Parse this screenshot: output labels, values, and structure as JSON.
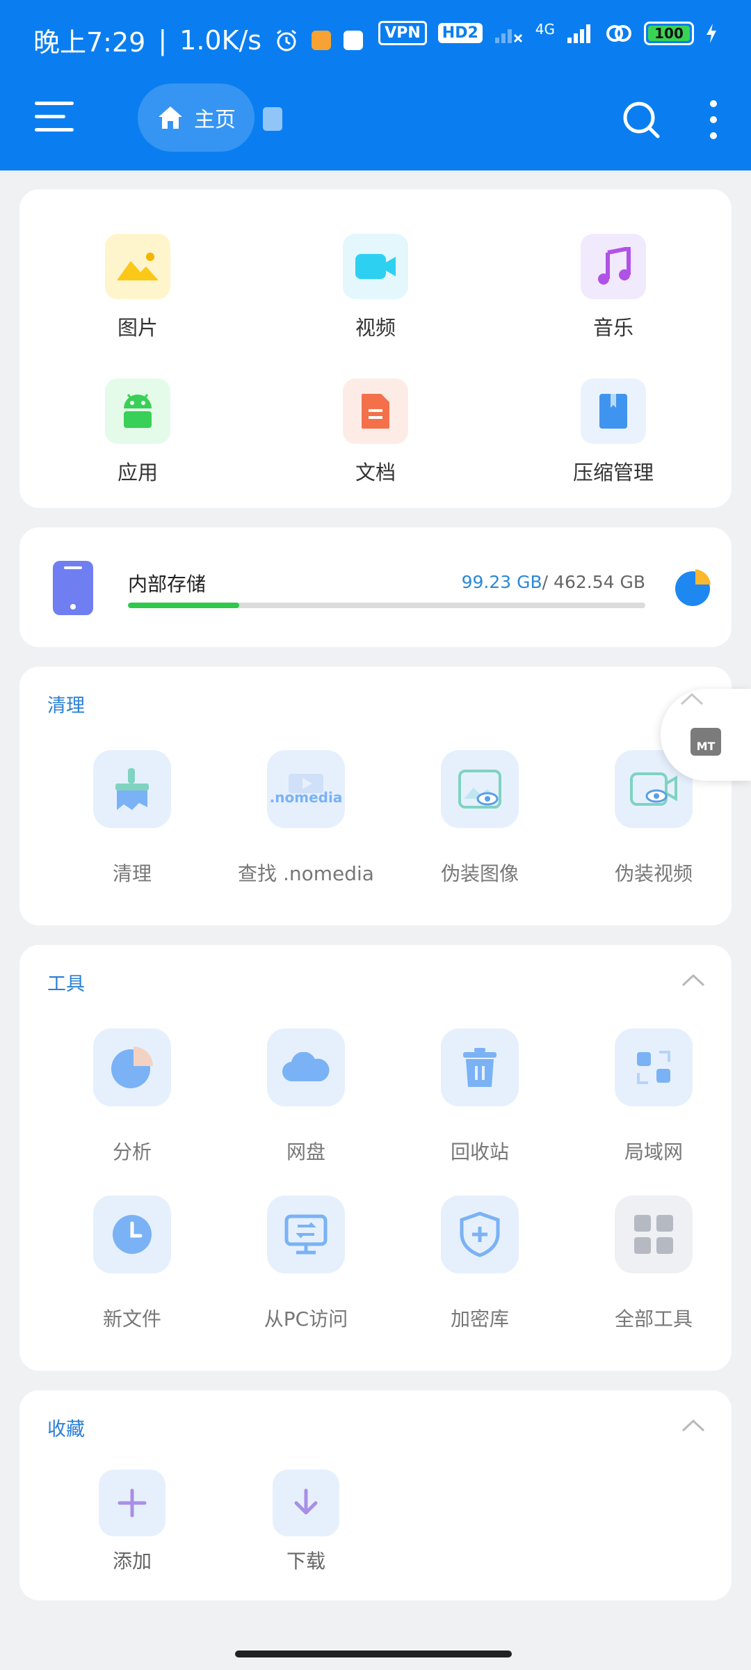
{
  "status_bar": {
    "time": "晚上7:29",
    "speed": "1.0K/s",
    "vpn": "VPN",
    "hd": "HD2",
    "network": "4G",
    "battery": "100"
  },
  "app_bar": {
    "home_label": "主页"
  },
  "categories": [
    {
      "label": "图片",
      "icon": "image-icon"
    },
    {
      "label": "视频",
      "icon": "video-icon"
    },
    {
      "label": "音乐",
      "icon": "music-icon"
    },
    {
      "label": "应用",
      "icon": "android-icon"
    },
    {
      "label": "文档",
      "icon": "document-icon"
    },
    {
      "label": "压缩管理",
      "icon": "archive-icon"
    }
  ],
  "storage": {
    "title": "内部存储",
    "used": "99.23 GB",
    "separator": "/",
    "total": "462.54 GB",
    "used_fraction": 0.2145
  },
  "clean": {
    "title": "清理",
    "items": [
      {
        "label": "清理",
        "icon": "broom-icon"
      },
      {
        "label": "查找 .nomedia",
        "icon": "nomedia-icon",
        "badge": ".nomedia"
      },
      {
        "label": "伪装图像",
        "icon": "disguise-image-icon"
      },
      {
        "label": "伪装视频",
        "icon": "disguise-video-icon"
      }
    ]
  },
  "tools": {
    "title": "工具",
    "items": [
      {
        "label": "分析",
        "icon": "analysis-pie-icon"
      },
      {
        "label": "网盘",
        "icon": "cloud-icon"
      },
      {
        "label": "回收站",
        "icon": "trash-icon"
      },
      {
        "label": "局域网",
        "icon": "lan-icon"
      },
      {
        "label": "新文件",
        "icon": "clock-icon"
      },
      {
        "label": "从PC访问",
        "icon": "pc-access-icon"
      },
      {
        "label": "加密库",
        "icon": "shield-plus-icon"
      },
      {
        "label": "全部工具",
        "icon": "grid-icon"
      }
    ]
  },
  "favorites": {
    "title": "收藏",
    "items": [
      {
        "label": "添加",
        "icon": "plus-icon"
      },
      {
        "label": "下载",
        "icon": "download-arrow-icon"
      }
    ]
  },
  "floating": {
    "label": "MT"
  },
  "colors": {
    "primary": "#0a7ef0",
    "accent_text": "#2a7fd6",
    "storage_fill": "#2ec94a"
  }
}
